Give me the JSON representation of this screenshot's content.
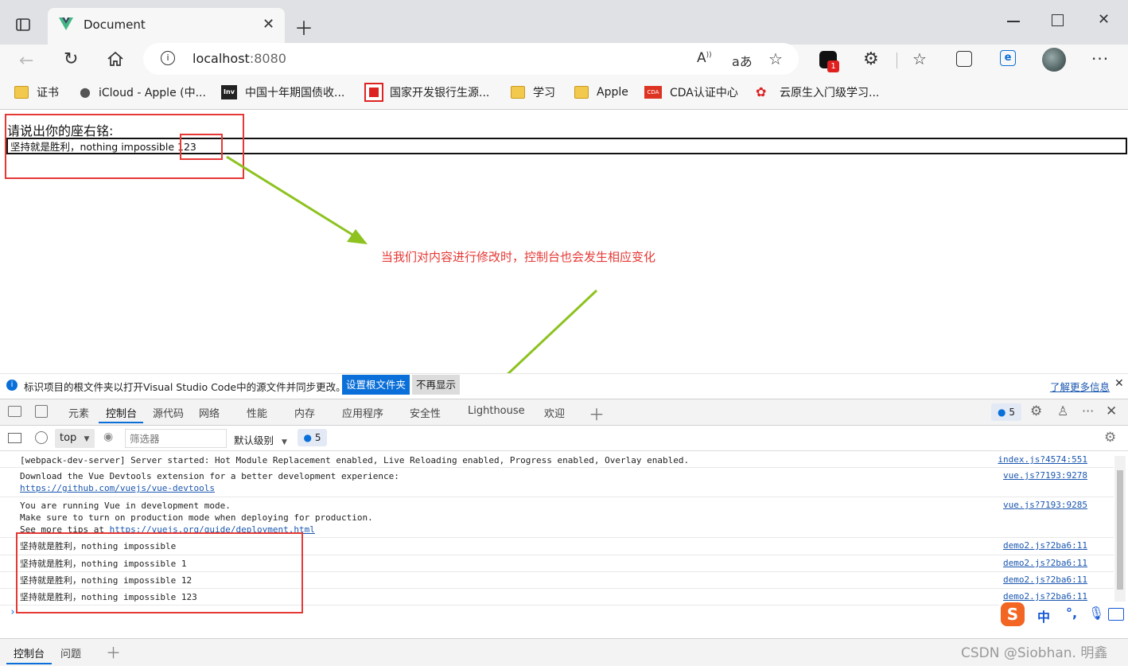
{
  "browser": {
    "tab_title": "Document",
    "url_host": "localhost",
    "url_port": ":8080",
    "read_aloud_label": "A",
    "translate_label": "aあ",
    "extension_badge": "1"
  },
  "bookmarks": [
    {
      "label": "证书",
      "icon": "folder-icon"
    },
    {
      "label": "iCloud - Apple (中...",
      "icon": "apple-icon"
    },
    {
      "label": "中国十年期国债收...",
      "icon": "inv-icon",
      "icon_text": "Inv"
    },
    {
      "label": "国家开发银行生源...",
      "icon": "cdb-icon"
    },
    {
      "label": "学习",
      "icon": "folder-icon"
    },
    {
      "label": "Apple",
      "icon": "folder-icon"
    },
    {
      "label": "CDA认证中心",
      "icon": "cda-icon",
      "icon_text": "CDA"
    },
    {
      "label": "云原生入门级学习...",
      "icon": "huawei-icon"
    }
  ],
  "page": {
    "prompt_label": "请说出你的座右铭:",
    "motto_value": "坚持就是胜利，nothing impossible 123",
    "annotation": "当我们对内容进行修改时，控制台也会发生相应变化"
  },
  "infobar": {
    "message": "标识项目的根文件夹以打开Visual Studio Code中的源文件并同步更改。",
    "set_root_button": "设置根文件夹",
    "dont_show_button": "不再显示",
    "learn_more": "了解更多信息"
  },
  "devtools": {
    "tabs": [
      "元素",
      "控制台",
      "源代码",
      "网络",
      "性能",
      "内存",
      "应用程序",
      "安全性",
      "Lighthouse",
      "欢迎"
    ],
    "active_tab": "控制台",
    "message_count": "5",
    "context": "top",
    "filter_placeholder": "筛选器",
    "level": "默认级别",
    "filter_count": "5"
  },
  "console": {
    "messages": [
      {
        "text": "[webpack-dev-server] Server started: Hot Module Replacement enabled, Live Reloading enabled, Progress enabled, Overlay enabled.",
        "source": "index.js?4574:551"
      },
      {
        "text": "Download the Vue Devtools extension for a better development experience:",
        "link": "https://github.com/vuejs/vue-devtools",
        "source": "vue.js?7193:9278"
      },
      {
        "text": "You are running Vue in development mode.\nMake sure to turn on production mode when deploying for production.\nSee more tips at ",
        "link": "https://vuejs.org/guide/deployment.html",
        "source": "vue.js?7193:9285"
      },
      {
        "text": "坚持就是胜利，nothing impossible",
        "source": "demo2.js?2ba6:11"
      },
      {
        "text": "坚持就是胜利，nothing impossible 1",
        "source": "demo2.js?2ba6:11"
      },
      {
        "text": "坚持就是胜利，nothing impossible 12",
        "source": "demo2.js?2ba6:11"
      },
      {
        "text": "坚持就是胜利，nothing impossible 123",
        "source": "demo2.js?2ba6:11"
      }
    ],
    "prompt": "›"
  },
  "drawer": {
    "tabs": [
      "控制台",
      "问题"
    ]
  },
  "ime": {
    "label": "中",
    "punct": "°,"
  },
  "watermark": "CSDN @Siobhan. 明鑫",
  "colors": {
    "accent": "#0a6fd8",
    "annotation_red": "#e53935",
    "arrow_green": "#8dc21f",
    "link_blue": "#1a57b0"
  }
}
